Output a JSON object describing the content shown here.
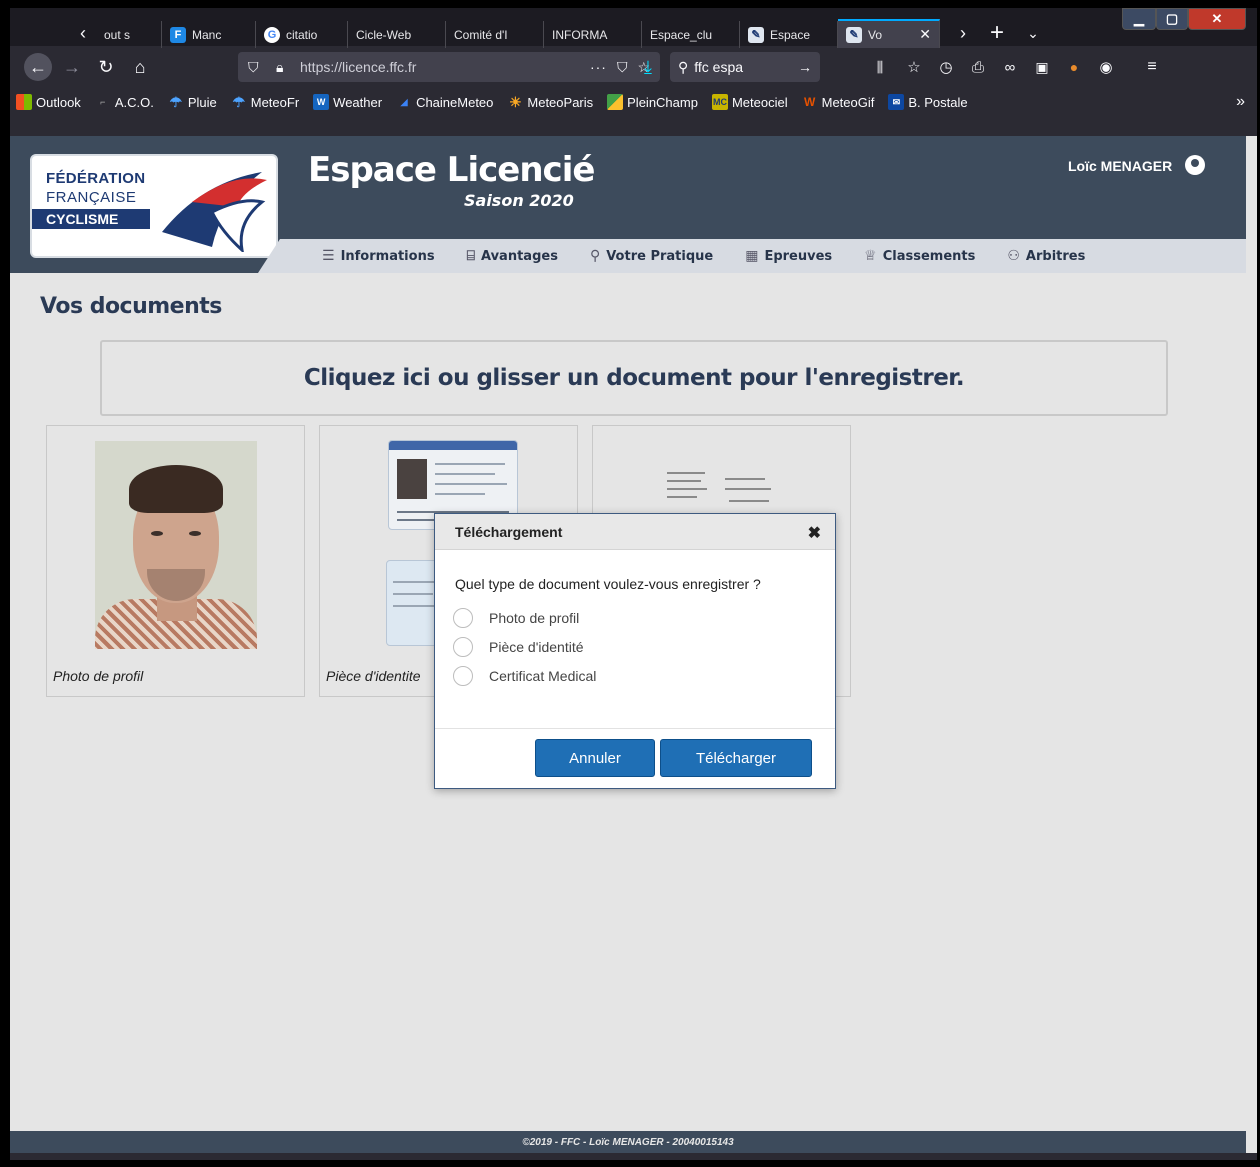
{
  "tabs": [
    {
      "label": "out s"
    },
    {
      "label": "Manc"
    },
    {
      "label": "citatio"
    },
    {
      "label": "Cicle-Web"
    },
    {
      "label": "Comité d'I"
    },
    {
      "label": "INFORMA"
    },
    {
      "label": "Espace_clu"
    },
    {
      "label": "Espace"
    },
    {
      "label": "Vo"
    }
  ],
  "browser": {
    "url": "https://licence.ffc.fr",
    "search_value": "ffc espa"
  },
  "bookmarks": [
    {
      "label": "Outlook",
      "color": "#f25022"
    },
    {
      "label": "A.C.O.",
      "color": "#777777"
    },
    {
      "label": "Pluie",
      "color": "#1e88e5"
    },
    {
      "label": "MeteoFr",
      "color": "#1e88e5"
    },
    {
      "label": "Weather",
      "color": "#1565c0"
    },
    {
      "label": "ChaineMeteo",
      "color": "#1976d2"
    },
    {
      "label": "MeteoParis",
      "color": "#f9a825"
    },
    {
      "label": "PleinChamp",
      "color": "#43a047"
    },
    {
      "label": "Meteociel",
      "color": "#c8b400"
    },
    {
      "label": "MeteoGif",
      "color": "#e65100"
    },
    {
      "label": "B. Postale",
      "color": "#0d47a1"
    }
  ],
  "site": {
    "logo": {
      "line1": "FÉDÉRATION",
      "line2": "FRANÇAISE",
      "line3": "CYCLISME"
    },
    "title": "Espace Licencié",
    "subtitle": "Saison 2020",
    "user": "Loïc MENAGER",
    "menu": [
      {
        "label": "Informations",
        "icon": "info-icon"
      },
      {
        "label": "Avantages",
        "icon": "gift-icon"
      },
      {
        "label": "Votre Pratique",
        "icon": "bike-icon"
      },
      {
        "label": "Epreuves",
        "icon": "calendar-icon"
      },
      {
        "label": "Classements",
        "icon": "trophy-icon"
      },
      {
        "label": "Arbitres",
        "icon": "group-icon"
      }
    ]
  },
  "page": {
    "title": "Vos documents",
    "dropzone": "Cliquez ici ou glisser un document pour l'enregistrer.",
    "documents": [
      {
        "caption": "Photo de profil"
      },
      {
        "caption": "Pièce d'identite"
      },
      {
        "caption": ""
      }
    ]
  },
  "modal": {
    "title": "Téléchargement",
    "question": "Quel type de document voulez-vous enregistrer ?",
    "options": [
      "Photo de profil",
      "Pièce d'identité",
      "Certificat Medical"
    ],
    "cancel": "Annuler",
    "submit": "Télécharger"
  },
  "footer": "©2019 - FFC - Loïc MENAGER - 20040015143",
  "colors": {
    "header": "#3d4b5c",
    "menu": "#d7dbe2",
    "accent": "#1f6fb5",
    "brand_blue": "#1e3a73"
  }
}
